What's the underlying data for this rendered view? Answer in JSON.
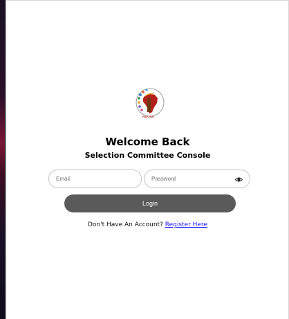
{
  "logo": {
    "text": "PAPZSN",
    "icon": "africa-logo-icon"
  },
  "header": {
    "title": "Welcome Back",
    "subtitle": "Selection Committee Console"
  },
  "form": {
    "email_placeholder": "Email",
    "password_placeholder": "Password",
    "login_label": "Login",
    "password_toggle_icon": "eye-icon"
  },
  "footer": {
    "prompt": "Don't Have An Account?",
    "register_link": "Register Here"
  },
  "colors": {
    "button": "#5a5a5a",
    "link": "#1a1aff"
  }
}
